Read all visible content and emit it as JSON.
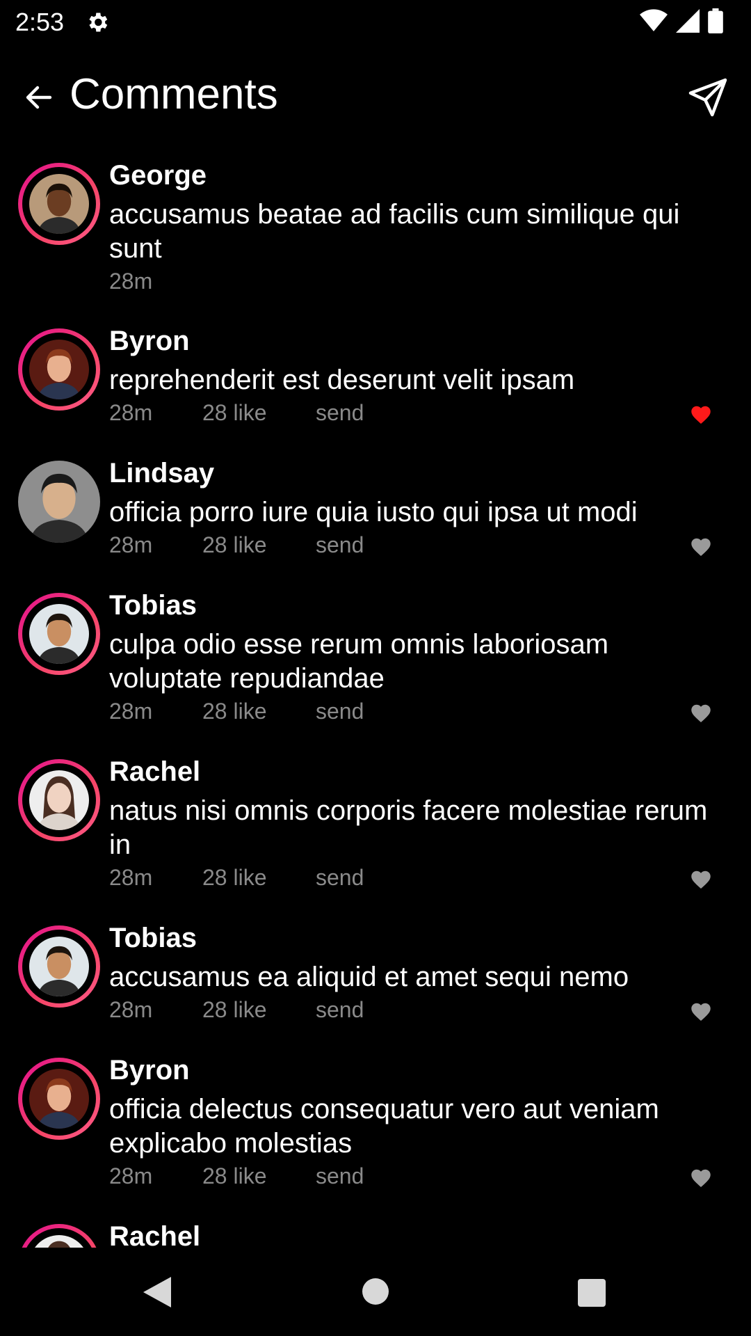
{
  "status": {
    "time": "2:53"
  },
  "header": {
    "title": "Comments"
  },
  "comments": [
    {
      "user": "George",
      "text": "accusamus beatae ad facilis cum similique qui sunt",
      "time": "28m",
      "likes": "",
      "send": "",
      "liked": false,
      "show_heart": false,
      "avatar_ring": true,
      "avatar_desc": "man-dark-skin"
    },
    {
      "user": "Byron",
      "text": "reprehenderit est deserunt velit ipsam",
      "time": "28m",
      "likes": "28 like",
      "send": "send",
      "liked": true,
      "show_heart": true,
      "avatar_ring": true,
      "avatar_desc": "man-red-hair"
    },
    {
      "user": "Lindsay",
      "text": "officia porro iure quia iusto qui ipsa ut modi",
      "time": "28m",
      "likes": "28 like",
      "send": "send",
      "liked": false,
      "show_heart": true,
      "avatar_ring": false,
      "avatar_desc": "man-grey-bg"
    },
    {
      "user": "Tobias",
      "text": "culpa odio esse rerum omnis laboriosam voluptate repudiandae",
      "time": "28m",
      "likes": "28 like",
      "send": "send",
      "liked": false,
      "show_heart": true,
      "avatar_ring": true,
      "avatar_desc": "man-smiling"
    },
    {
      "user": "Rachel",
      "text": "natus nisi omnis corporis facere molestiae rerum in",
      "time": "28m",
      "likes": "28 like",
      "send": "send",
      "liked": false,
      "show_heart": true,
      "avatar_ring": true,
      "avatar_desc": "woman-long-hair"
    },
    {
      "user": "Tobias",
      "text": "accusamus ea aliquid et amet sequi nemo",
      "time": "28m",
      "likes": "28 like",
      "send": "send",
      "liked": false,
      "show_heart": true,
      "avatar_ring": true,
      "avatar_desc": "man-smiling"
    },
    {
      "user": "Byron",
      "text": "officia delectus consequatur vero aut veniam explicabo molestias",
      "time": "28m",
      "likes": "28 like",
      "send": "send",
      "liked": false,
      "show_heart": true,
      "avatar_ring": true,
      "avatar_desc": "man-red-hair"
    },
    {
      "user": "Rachel",
      "text": "",
      "time": "",
      "likes": "",
      "send": "",
      "liked": false,
      "show_heart": false,
      "avatar_ring": true,
      "avatar_desc": "woman-long-hair"
    }
  ],
  "colors": {
    "liked": "#ff1a1a",
    "unliked": "#9a9a9a",
    "ring_start": "#e4108f",
    "ring_end": "#ff5b8a",
    "meta": "#8a8a8a"
  },
  "icons": {
    "back": "arrow-left-icon",
    "send": "paper-plane-icon",
    "heart": "heart-icon",
    "settings": "gear-icon"
  }
}
